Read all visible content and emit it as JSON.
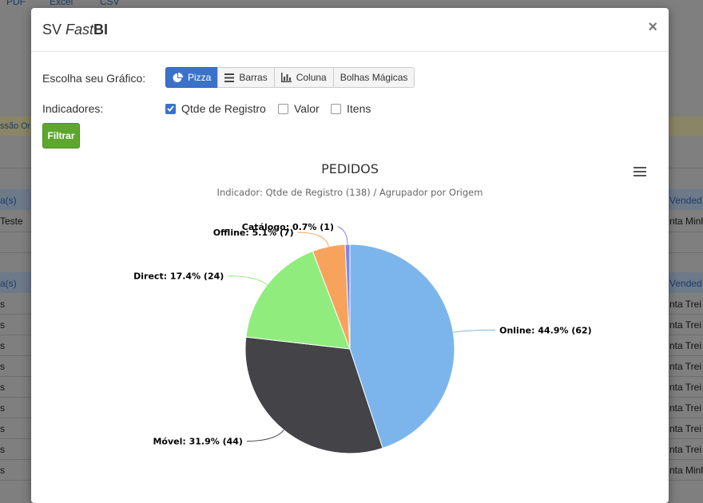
{
  "background": {
    "top_links": [
      "PDF",
      "Excel",
      "CSV"
    ],
    "warn_left": "ssão",
    "warn_left2": "Ori",
    "header1_left": "a(s)",
    "header1_right": "Vended",
    "row1_left": "Teste",
    "row1_right": "nta Minh",
    "header2_left": "a(s)",
    "header2_right": "Vended",
    "rows_left": [
      "s",
      "s",
      "s",
      "s",
      "s",
      "s",
      "s",
      "s",
      "s"
    ],
    "rows_right": [
      "nta Trei",
      "nta Trei",
      "nta Trei",
      "nta Trei",
      "nta Trei",
      "nta Trei",
      "nta Trei",
      "nta Trei",
      "nta Minh"
    ]
  },
  "modal": {
    "title_prefix": "SV ",
    "title_fast": "Fast",
    "title_bi": "BI",
    "close_label": "×"
  },
  "form": {
    "chart_label": "Escolha seu Gráfico:",
    "chart_buttons": [
      {
        "label": "Pizza",
        "icon": "pie-icon",
        "active": true
      },
      {
        "label": "Barras",
        "icon": "bars-icon",
        "active": false
      },
      {
        "label": "Coluna",
        "icon": "column-chart-icon",
        "active": false
      },
      {
        "label": "Bolhas Mágicas",
        "icon": "",
        "active": false
      }
    ],
    "indicators_label": "Indicadores:",
    "indicators": [
      {
        "label": "Qtde de Registro",
        "checked": true
      },
      {
        "label": "Valor",
        "checked": false
      },
      {
        "label": "Itens",
        "checked": false
      }
    ],
    "filter_label": "Filtrar"
  },
  "chart_data": {
    "type": "pie",
    "title": "PEDIDOS",
    "subtitle": "Indicador: Qtde de Registro (138) / Agrupador por Origem",
    "slices": [
      {
        "name": "Online",
        "value": 62,
        "percent": 44.9,
        "label": "Online: 44.9% (62)",
        "color": "#7cb5ec"
      },
      {
        "name": "Móvel",
        "value": 44,
        "percent": 31.9,
        "label": "Móvel: 31.9% (44)",
        "color": "#434348"
      },
      {
        "name": "Direct",
        "value": 24,
        "percent": 17.4,
        "label": "Direct: 17.4% (24)",
        "color": "#90ed7d"
      },
      {
        "name": "Offline",
        "value": 7,
        "percent": 5.1,
        "label": "Offline: 5.1% (7)",
        "color": "#f7a35c"
      },
      {
        "name": "Catálogo",
        "value": 1,
        "percent": 0.7,
        "label": "Catálogo: 0.7% (1)",
        "color": "#8085e9"
      }
    ]
  }
}
